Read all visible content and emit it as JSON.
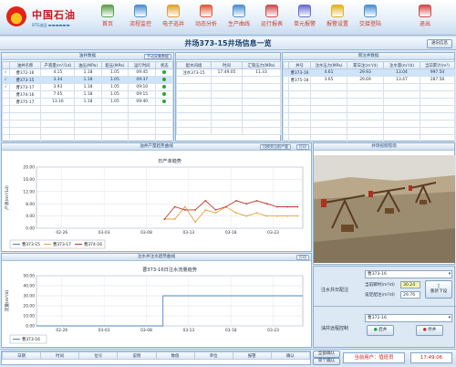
{
  "header": {
    "logo_text": "中国石油",
    "logo_sub": "BTS油田 ▬▬▬▬▬▬",
    "toolbar": [
      {
        "label": "首页",
        "icon": "home-icon",
        "color": "#5aa04a"
      },
      {
        "label": "流程监控",
        "icon": "flow-icon",
        "color": "#4a8fd0"
      },
      {
        "label": "电子巡井",
        "icon": "patrol-icon",
        "color": "#e0a030"
      },
      {
        "label": "动态分析",
        "icon": "analysis-icon",
        "color": "#e05a3a"
      },
      {
        "label": "生产曲线",
        "icon": "curve-icon",
        "color": "#4a8fd0"
      },
      {
        "label": "运行报表",
        "icon": "report-icon",
        "color": "#d04a4a"
      },
      {
        "label": "单元报警",
        "icon": "alarm-icon",
        "color": "#6a6ad0"
      },
      {
        "label": "报警设置",
        "icon": "alarm-settings-icon",
        "color": "#e0b020"
      },
      {
        "label": "交接登陆",
        "icon": "login-icon",
        "color": "#4a8fd0"
      },
      {
        "label": "退出",
        "icon": "exit-icon",
        "color": "#d04a4a"
      }
    ]
  },
  "page": {
    "title": "井场373-15井场信息一览",
    "top_button": "通讯信息"
  },
  "oil_panel": {
    "title": "油井数据",
    "button": "手动采集数据",
    "columns": [
      "油井名称",
      "产液量(m³/1d)",
      "油压(MPa)",
      "套压(MPa)",
      "运行时间",
      "状态"
    ],
    "rows": [
      {
        "check": "√",
        "name": "曹372-16",
        "v1": "4.15",
        "v2": "1.18",
        "v3": "1.05",
        "v4": "09:45"
      },
      {
        "check": "√",
        "name": "曹373-15",
        "v1": "3.34",
        "v2": "1.18",
        "v3": "1.05",
        "v4": "09:37"
      },
      {
        "check": "√",
        "name": "曹373-17",
        "v1": "3.93",
        "v2": "1.18",
        "v3": "1.05",
        "v4": "09:10"
      },
      {
        "check": "",
        "name": "曹374-16",
        "v1": "7.05",
        "v2": "1.18",
        "v3": "1.05",
        "v4": "09:15"
      },
      {
        "check": "",
        "name": "曹375-17",
        "v1": "13.16",
        "v2": "1.18",
        "v3": "1.05",
        "v4": "09:40"
      }
    ]
  },
  "dist_panel": {
    "title": "",
    "columns": [
      "配水间组",
      "时间",
      "汇管压力(MPa)"
    ],
    "row": {
      "name": "注水373-15",
      "time": "17:49:05",
      "value": "11.33"
    }
  },
  "water_panel": {
    "title": "增注井数据",
    "columns": [
      "井号",
      "注水压力(MPa)",
      "累日注(m³/d)",
      "注水量(m³/d)",
      "当前累计(m³)"
    ],
    "rows": [
      {
        "name": "曹373-16",
        "v1": "4.61",
        "v2": "29.93",
        "v3": "13.04",
        "v4": "997.54"
      },
      {
        "name": "曹375-18",
        "v1": "3.65",
        "v2": "29.69",
        "v3": "13.47",
        "v4": "287.58"
      }
    ]
  },
  "chart1_panel": {
    "title": "油井产量趋势曲线",
    "btn1": "切换到当前产量",
    "btn2": "打印"
  },
  "chart2_panel": {
    "title": "注水井注水趋势曲线",
    "btn": "打印"
  },
  "photo_panel": {
    "title": "井场视频现场"
  },
  "chart_data": [
    {
      "type": "line",
      "title": "日产液趋势",
      "ylabel": "产液(m³/1d)",
      "xlabel": "",
      "ylim": [
        0,
        20
      ],
      "yticks": [
        "0.00",
        "4.00",
        "8.00",
        "12.00",
        "16.00",
        "20.00"
      ],
      "xticks": [
        "02-26",
        "03-03",
        "03-08",
        "03-13",
        "03-18",
        "03-23"
      ],
      "x": [
        0,
        1,
        2,
        3,
        4,
        5,
        6,
        7,
        8,
        9,
        10,
        11,
        12,
        13,
        14,
        15,
        16,
        17,
        18,
        19,
        20,
        21,
        22,
        23,
        24,
        25
      ],
      "series": [
        {
          "name": "曹373-15",
          "color": "#4a84c8",
          "values": [
            null,
            null,
            null,
            null,
            null,
            null,
            null,
            null,
            null,
            null,
            null,
            null,
            null,
            null,
            null,
            null,
            null,
            null,
            null,
            null,
            null,
            null,
            null,
            null,
            null,
            null
          ]
        },
        {
          "name": "曹373-17",
          "color": "#e8a23a",
          "values": [
            null,
            null,
            null,
            null,
            null,
            null,
            null,
            null,
            null,
            null,
            null,
            null,
            3,
            3,
            7,
            2,
            6,
            5,
            7,
            5,
            4,
            5,
            4,
            4,
            4,
            4
          ]
        },
        {
          "name": "曹374-16",
          "color": "#c0392b",
          "values": [
            null,
            null,
            null,
            null,
            null,
            null,
            null,
            null,
            null,
            null,
            null,
            null,
            3,
            7,
            6,
            6,
            9,
            6,
            7,
            9,
            8,
            9,
            8,
            7,
            7,
            7
          ]
        }
      ],
      "legend": "bottom-left"
    },
    {
      "type": "line",
      "title": "曹373-16日注水流量趋势",
      "ylabel": "流量(m³/d)",
      "ylim": [
        0,
        50
      ],
      "yticks": [
        "0.00",
        "10.00",
        "20.00",
        "30.00",
        "40.00",
        "50.00"
      ],
      "xticks": [
        "02-26",
        "03-03",
        "03-08",
        "03-13",
        "03-18",
        "03-23"
      ],
      "x": [
        0,
        25
      ],
      "series": [
        {
          "name": "曹373-16",
          "color": "#4a84c8",
          "values": [
            0,
            0,
            30
          ]
        }
      ],
      "legend": "bottom-left"
    }
  ],
  "injection_control": {
    "label": "注水井日配注",
    "well": "曹373-16",
    "rate_label": "当前瞬时(m³/d)",
    "rate_value": "30.24",
    "set_label": "设定配注(m³/d)",
    "set_value": "29.76",
    "button": "重新下设"
  },
  "remote_control": {
    "label": "油井远程控制",
    "well": "曹372-16",
    "start": "启井",
    "stop": "停井"
  },
  "alarm_table": {
    "columns": [
      "日期",
      "时间",
      "位号",
      "说明",
      "数值",
      "单位",
      "报警",
      "确认"
    ]
  },
  "status": {
    "all_btn": "全部确认",
    "single_btn": "单个确认",
    "user_label": "当前用户：值班员",
    "time": "17:49:06"
  }
}
